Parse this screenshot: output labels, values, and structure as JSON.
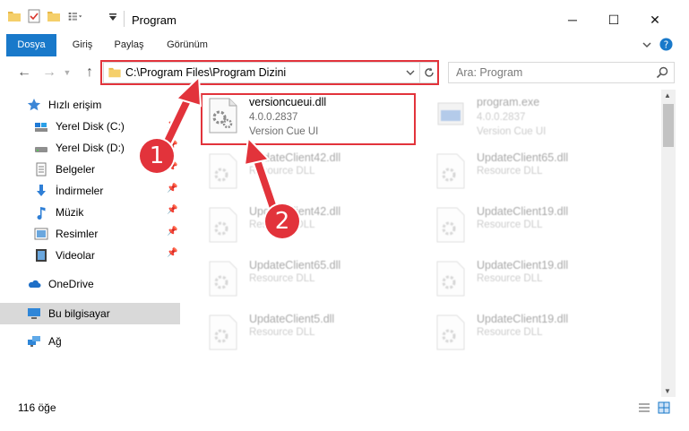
{
  "window": {
    "title": "Program",
    "min_glyph": "─",
    "max_glyph": "☐",
    "close_glyph": "✕"
  },
  "ribbon": {
    "tabs": [
      {
        "label": "Dosya"
      },
      {
        "label": "Giriş"
      },
      {
        "label": "Paylaş"
      },
      {
        "label": "Görünüm"
      }
    ]
  },
  "nav": {
    "back_glyph": "←",
    "forward_glyph": "→",
    "up_glyph": "↑",
    "address": "C:\\Program Files\\Program Dizini",
    "search_placeholder": "Ara: Program"
  },
  "sidebar": {
    "items": [
      {
        "label": "Hızlı erişim",
        "icon": "star-icon"
      },
      {
        "label": "Yerel Disk (C:)",
        "icon": "drive-icon"
      },
      {
        "label": "Yerel Disk (D:)",
        "icon": "drive-icon"
      },
      {
        "label": "Belgeler",
        "icon": "documents-icon"
      },
      {
        "label": "İndirmeler",
        "icon": "download-icon"
      },
      {
        "label": "Müzik",
        "icon": "music-icon"
      },
      {
        "label": "Resimler",
        "icon": "pictures-icon"
      },
      {
        "label": "Videolar",
        "icon": "video-icon"
      },
      {
        "label": "OneDrive",
        "icon": "cloud-icon"
      },
      {
        "label": "Bu bilgisayar",
        "icon": "computer-icon"
      },
      {
        "label": "Ağ",
        "icon": "network-icon"
      }
    ]
  },
  "files": {
    "highlighted": {
      "name": "versioncueui.dll",
      "version": "4.0.0.2837",
      "description": "Version Cue UI"
    },
    "program": {
      "name": "program.exe",
      "version": "4.0.0.2837",
      "description": "Version Cue UI"
    },
    "others": [
      {
        "name": "UpdateClient42.dll",
        "description": "Resource DLL"
      },
      {
        "name": "UpdateClient65.dll",
        "description": "Resource DLL"
      },
      {
        "name": "UpdateClient42.dll",
        "description": "Resource DLL"
      },
      {
        "name": "UpdateClient19.dll",
        "description": "Resource DLL"
      },
      {
        "name": "UpdateClient65.dll",
        "description": "Resource DLL"
      },
      {
        "name": "UpdateClient19.dll",
        "description": "Resource DLL"
      },
      {
        "name": "UpdateClient5.dll",
        "description": "Resource DLL"
      },
      {
        "name": "UpdateClient19.dll",
        "description": "Resource DLL"
      }
    ]
  },
  "status": {
    "count": "116 öğe"
  },
  "annotations": {
    "step1": "1",
    "step2": "2"
  },
  "colors": {
    "accent": "#1979ca",
    "annotation": "#e2333b",
    "folder": "#e8b84a"
  }
}
